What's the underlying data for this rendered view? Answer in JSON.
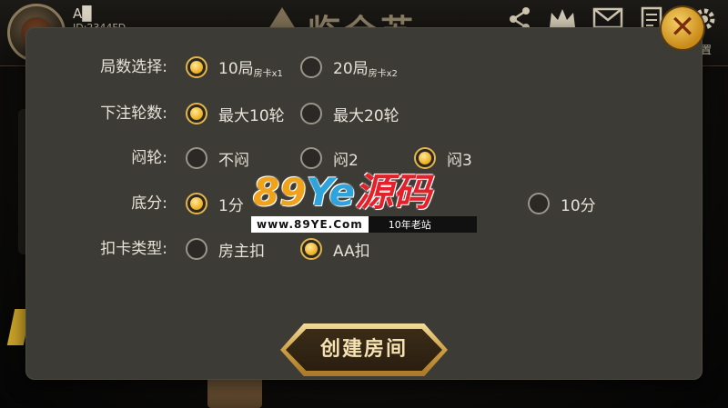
{
  "header": {
    "user_name": "A▉",
    "user_id": "ID:2344FD",
    "logo_text": "临全苏",
    "settings_label": "置"
  },
  "dialog": {
    "rows": [
      {
        "label": "局数选择:",
        "options": [
          {
            "text": "10局",
            "sub": "房卡x1",
            "selected": true
          },
          {
            "text": "20局",
            "sub": "房卡x2",
            "selected": false
          }
        ]
      },
      {
        "label": "下注轮数:",
        "options": [
          {
            "text": "最大10轮",
            "selected": true
          },
          {
            "text": "最大20轮",
            "selected": false
          }
        ]
      },
      {
        "label": "闷轮:",
        "options": [
          {
            "text": "不闷",
            "selected": false
          },
          {
            "text": "闷2",
            "selected": false
          },
          {
            "text": "闷3",
            "selected": true
          }
        ]
      },
      {
        "label": "底分:",
        "options": [
          {
            "text": "1分",
            "selected": true
          },
          {
            "text": "10分",
            "selected": false
          }
        ]
      },
      {
        "label": "扣卡类型:",
        "options": [
          {
            "text": "房主扣",
            "selected": false
          },
          {
            "text": "AA扣",
            "selected": true
          }
        ]
      }
    ],
    "create_button": "创建房间"
  },
  "watermark": {
    "num": "89",
    "ye": "Ye",
    "cn": "源码",
    "url": "www.89YE.Com",
    "tag": "10年老站"
  },
  "colors": {
    "accent_gold": "#e3b54a",
    "dialog_bg": "#3d3b35",
    "text": "#e6e2d8"
  },
  "icons": [
    "share-icon",
    "crown-icon",
    "mail-icon",
    "document-icon",
    "gear-icon",
    "close-icon"
  ]
}
